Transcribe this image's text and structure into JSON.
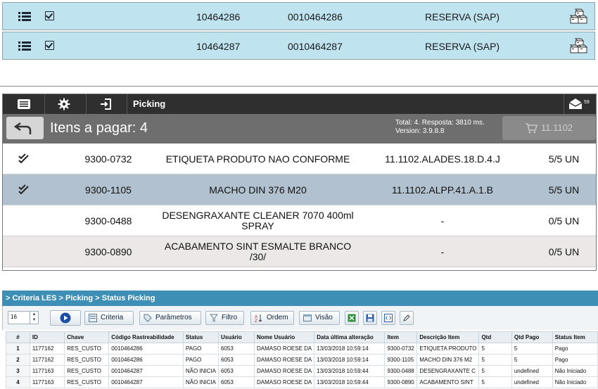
{
  "top_list": {
    "rows": [
      {
        "chave": "10464286",
        "codigo": "0010464286",
        "tipo": "RESERVA (SAP)"
      },
      {
        "chave": "10464287",
        "codigo": "0010464287",
        "tipo": "RESERVA (SAP)"
      }
    ]
  },
  "picking": {
    "title": "Picking",
    "mail_count": "59",
    "items_label": "Itens a pagar: 4",
    "status_line1": "Total: 4. Resposta: 3810 ms.",
    "status_line2": "Version: 3.9.8.8",
    "cart_label": "11.1102",
    "rows": [
      {
        "checked": true,
        "code": "9300-0732",
        "desc": "ETIQUETA PRODUTO NAO CONFORME",
        "location": "11.1102.ALADES.18.D.4.J",
        "qty": "5/5 UN",
        "bg": "#ffffff"
      },
      {
        "checked": true,
        "code": "9300-1105",
        "desc": "MACHO DIN 376 M20",
        "location": "11.1102.ALPP.41.A.1.B",
        "qty": "5/5 UN",
        "bg": "#b2c1cf"
      },
      {
        "checked": false,
        "code": "9300-0488",
        "desc": "DESENGRAXANTE CLEANER 7070 400ml SPRAY",
        "location": "-",
        "qty": "0/5 UN",
        "bg": "#ffffff"
      },
      {
        "checked": false,
        "code": "9300-0890",
        "desc": "ACABAMENTO SINT ESMALTE BRANCO /30/",
        "location": "-",
        "qty": "0/5 UN",
        "bg": "#ece8e8"
      }
    ]
  },
  "grid_panel": {
    "breadcrumb": "> Criteria LES > Picking > Status Picking",
    "page_size": "16",
    "buttons": {
      "criteria": "Criteria",
      "parametros": "Parâmetros",
      "filtro": "Filtro",
      "ordem": "Ordem",
      "visao": "Visão"
    },
    "columns": [
      "#",
      "ID",
      "Chave",
      "Código Rastreabilidade",
      "Status",
      "Usuário",
      "Nome Usuário",
      "Data última alteração",
      "Item",
      "Descrição Item",
      "Qtd",
      "Qtd Pago",
      "Status Item"
    ],
    "rows": [
      [
        "1",
        "1177162",
        "RES_CUSTO",
        "0010464286",
        "PAGO",
        "6053",
        "DAMASO ROESE DA",
        "13/03/2018 10:59:14",
        "9300-0732",
        "ETIQUETA PRODUTO",
        "5",
        "5",
        "Pago"
      ],
      [
        "2",
        "1177162",
        "RES_CUSTO",
        "0010464286",
        "PAGO",
        "6053",
        "DAMASO ROESE DA",
        "13/03/2018 10:59:14",
        "9300-1105",
        "MACHO DIN 376 M2",
        "5",
        "5",
        "Pago"
      ],
      [
        "3",
        "1177163",
        "RES_CUSTO",
        "0010464287",
        "NÃO INICIA",
        "6053",
        "DAMASO ROESE DA",
        "13/03/2018 10:59:44",
        "9300-0488",
        "DESENGRAXANTE C",
        "5",
        "undefined",
        "Não Iniciado"
      ],
      [
        "4",
        "1177163",
        "RES_CUSTO",
        "0010464287",
        "NÃO INICIA",
        "6053",
        "DAMASO ROESE DA",
        "13/03/2018 10:59:44",
        "9300-0890",
        "ACABAMENTO SINT",
        "5",
        "undefined",
        "Não Iniciado"
      ]
    ]
  },
  "icons": {
    "list": "list-icon",
    "check": "checkbox-icon",
    "boxes": "boxes-icon",
    "menu": "menu-icon",
    "gear": "gear-icon",
    "exit": "exit-icon",
    "mail": "mail-icon",
    "back": "back-arrow-icon",
    "cart": "cart-icon",
    "double_check": "double-check-icon"
  }
}
